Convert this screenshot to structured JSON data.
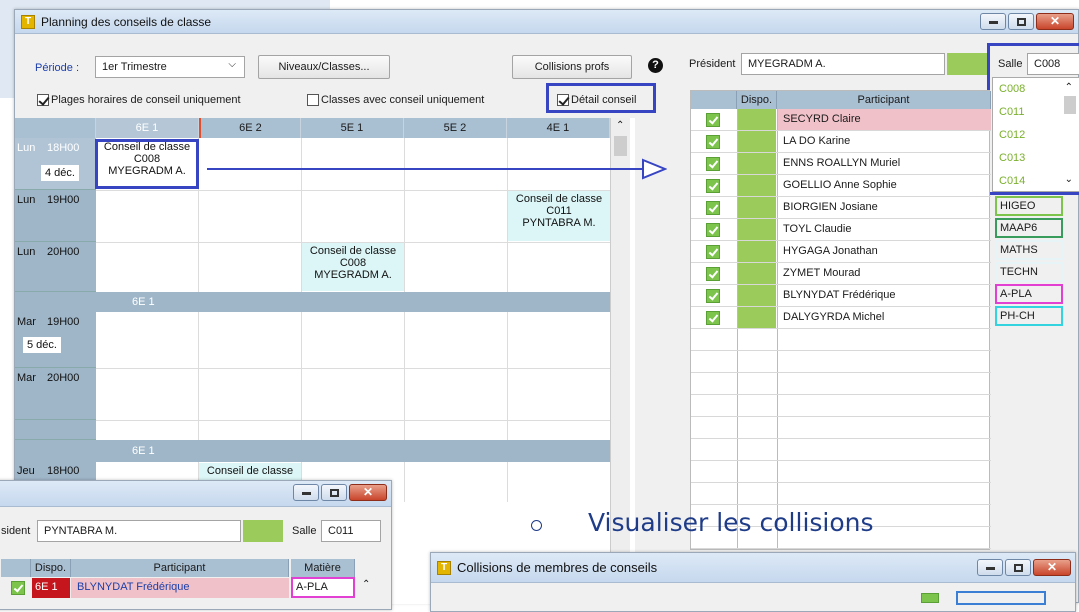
{
  "main_window": {
    "title": "Planning des conseils de classe",
    "periode_label": "Période :",
    "periode_value": "1er Trimestre",
    "niveaux_btn": "Niveaux/Classes...",
    "collisions_btn": "Collisions profs",
    "help_icon": "?",
    "chk_plages": "Plages horaires de conseil uniquement",
    "chk_classes": "Classes avec conseil uniquement",
    "chk_detail": "Détail conseil",
    "columns": [
      "6E 1",
      "6E 2",
      "5E 1",
      "5E 2",
      "4E 1"
    ],
    "rows": [
      {
        "day": "Lun",
        "time": "18H00",
        "date": "4 déc."
      },
      {
        "day": "Lun",
        "time": "19H00"
      },
      {
        "day": "Lun",
        "time": "20H00"
      },
      {
        "sep": "6E 1"
      },
      {
        "day": "Mar",
        "time": "19H00",
        "date": "5 déc."
      },
      {
        "day": "Mar",
        "time": "20H00"
      },
      {
        "sep": "6E 1"
      },
      {
        "day": "Jeu",
        "time": "18H00"
      }
    ],
    "conseils": [
      {
        "line1": "Conseil de classe",
        "line2": "C008",
        "line3": "MYEGRADM A."
      },
      {
        "line1": "Conseil de classe",
        "line2": "C011",
        "line3": "PYNTABRA M."
      },
      {
        "line1": "Conseil de classe",
        "line2": "C008",
        "line3": "MYEGRADM A."
      },
      {
        "line1": "Conseil de classe"
      }
    ]
  },
  "detail_panel": {
    "president_label": "Président",
    "president_value": "MYEGRADM A.",
    "salle_label": "Salle",
    "salle_value": "C008",
    "salle_options": [
      "C008",
      "C011",
      "C012",
      "C013",
      "C014"
    ],
    "col_dispo": "Dispo.",
    "col_participant": "Participant",
    "participants": [
      {
        "name": "SECYRD Claire",
        "matiere": ""
      },
      {
        "name": "LA DO Karine",
        "matiere": ""
      },
      {
        "name": "ENNS ROALLYN Muriel",
        "matiere": ""
      },
      {
        "name": "GOELLIO Anne Sophie",
        "matiere": ""
      },
      {
        "name": "BIORGIEN Josiane",
        "matiere": "HIGEO"
      },
      {
        "name": "TOYL Claudie",
        "matiere": "MAAP6"
      },
      {
        "name": "HYGAGA Jonathan",
        "matiere": "MATHS"
      },
      {
        "name": "ZYMET Mourad",
        "matiere": "TECHN"
      },
      {
        "name": "BLYNYDAT Frédérique",
        "matiere": "A-PLA"
      },
      {
        "name": "DALYGYRDA Michel",
        "matiere": "PH-CH"
      }
    ]
  },
  "small_window": {
    "president_label": "sident",
    "president_value": "PYNTABRA M.",
    "salle_label": "Salle",
    "salle_value": "C011",
    "col_dispo": "Dispo.",
    "col_participant": "Participant",
    "col_matiere": "Matière",
    "row_classe": "6E 1",
    "row_name": "BLYNYDAT Frédérique",
    "row_matiere": "A-PLA"
  },
  "collisions_window": {
    "title": "Collisions de membres de conseils"
  },
  "caption": "Visualiser les collisions"
}
